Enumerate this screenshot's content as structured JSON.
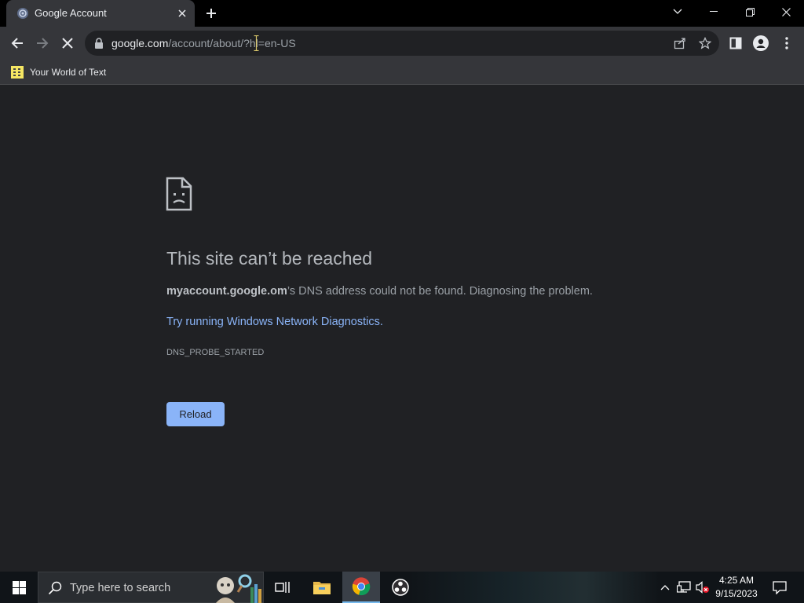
{
  "browser": {
    "tab": {
      "title": "Google Account"
    },
    "url": {
      "host": "google.com",
      "rest": "/account/about/?hl=en-US"
    },
    "bookmarks": [
      {
        "label": "Your World of Text"
      }
    ]
  },
  "error_page": {
    "title": "This site can’t be reached",
    "detail_host": "myaccount.google.om",
    "detail_text": "’s DNS address could not be found. Diagnosing the problem.",
    "link": "Try running Windows Network Diagnostics.",
    "error_code": "DNS_PROBE_STARTED",
    "reload_label": "Reload"
  },
  "taskbar": {
    "search_placeholder": "Type here to search",
    "time": "4:25 AM",
    "date": "9/15/2023"
  },
  "colors": {
    "accent_link": "#8ab4f8",
    "page_bg": "#202124",
    "chrome_bg": "#35363a"
  }
}
